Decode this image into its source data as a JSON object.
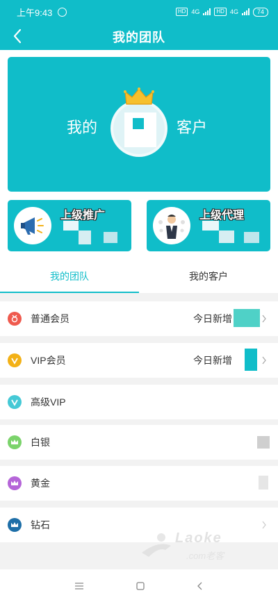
{
  "status_bar": {
    "time": "上午9:43",
    "battery": "74",
    "network_label": "4G"
  },
  "header": {
    "title": "我的团队"
  },
  "hero": {
    "left_text": "我的",
    "right_text": "客户"
  },
  "cards": [
    {
      "label": "上级推广",
      "icon": "megaphone-icon"
    },
    {
      "label": "上级代理",
      "icon": "agent-figure-icon"
    }
  ],
  "tabs": [
    {
      "label": "我的团队",
      "active": true
    },
    {
      "label": "我的客户",
      "active": false
    }
  ],
  "members": [
    {
      "name": "普通会员",
      "today": "今日新增",
      "icon_color": "#ef5a4e",
      "icon": "medal-icon"
    },
    {
      "name": "VIP会员",
      "today": "今日新增",
      "icon_color": "#f3b117",
      "icon": "vip-v-icon"
    },
    {
      "name": "高级VIP",
      "today": "",
      "icon_color": "#45c9d6",
      "icon": "vip-v-icon"
    },
    {
      "name": "白银",
      "today": "",
      "icon_color": "#7bd36b",
      "icon": "crown-icon"
    },
    {
      "name": "黄金",
      "today": "",
      "icon_color": "#b565d8",
      "icon": "crown-icon"
    },
    {
      "name": "钻石",
      "today": "",
      "icon_color": "#1e6fa8",
      "icon": "crown-icon"
    }
  ],
  "watermark": {
    "text": "Laoke",
    "sub": ".com老客"
  },
  "colors": {
    "accent": "#10bdc9"
  }
}
